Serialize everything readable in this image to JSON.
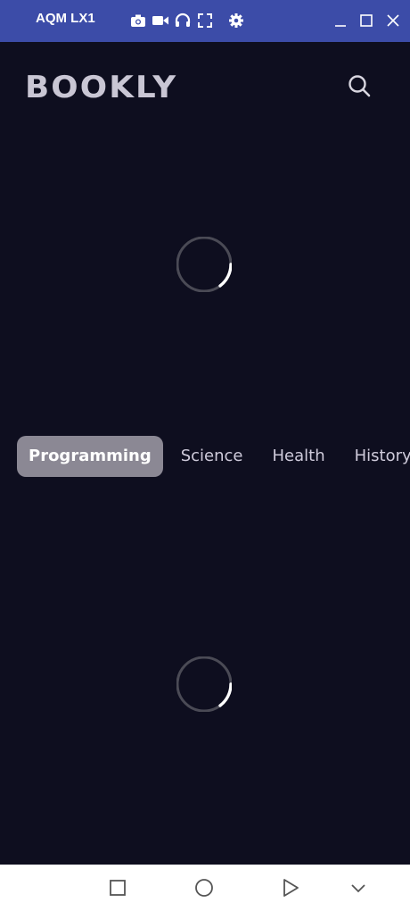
{
  "window": {
    "title": "AQM LX1",
    "toolbar_icons": [
      "camera-icon",
      "video-icon",
      "headphones-icon",
      "fullscreen-icon",
      "settings-icon"
    ],
    "controls": [
      "minimize-icon",
      "maximize-icon",
      "close-icon"
    ]
  },
  "app": {
    "logo_text": "BOOKLY",
    "search_icon": "search-icon",
    "categories": [
      {
        "label": "Programming",
        "active": true
      },
      {
        "label": "Science",
        "active": false
      },
      {
        "label": "Health",
        "active": false
      },
      {
        "label": "History",
        "active": false
      }
    ]
  },
  "navbar": {
    "buttons": [
      "square-icon",
      "circle-icon",
      "play-icon",
      "chevron-down-icon"
    ]
  },
  "colors": {
    "titlebar": "#3c4ca8",
    "background": "#0e0e1f",
    "chip_active": "#8b8894",
    "logo": "#c9c6d4"
  }
}
